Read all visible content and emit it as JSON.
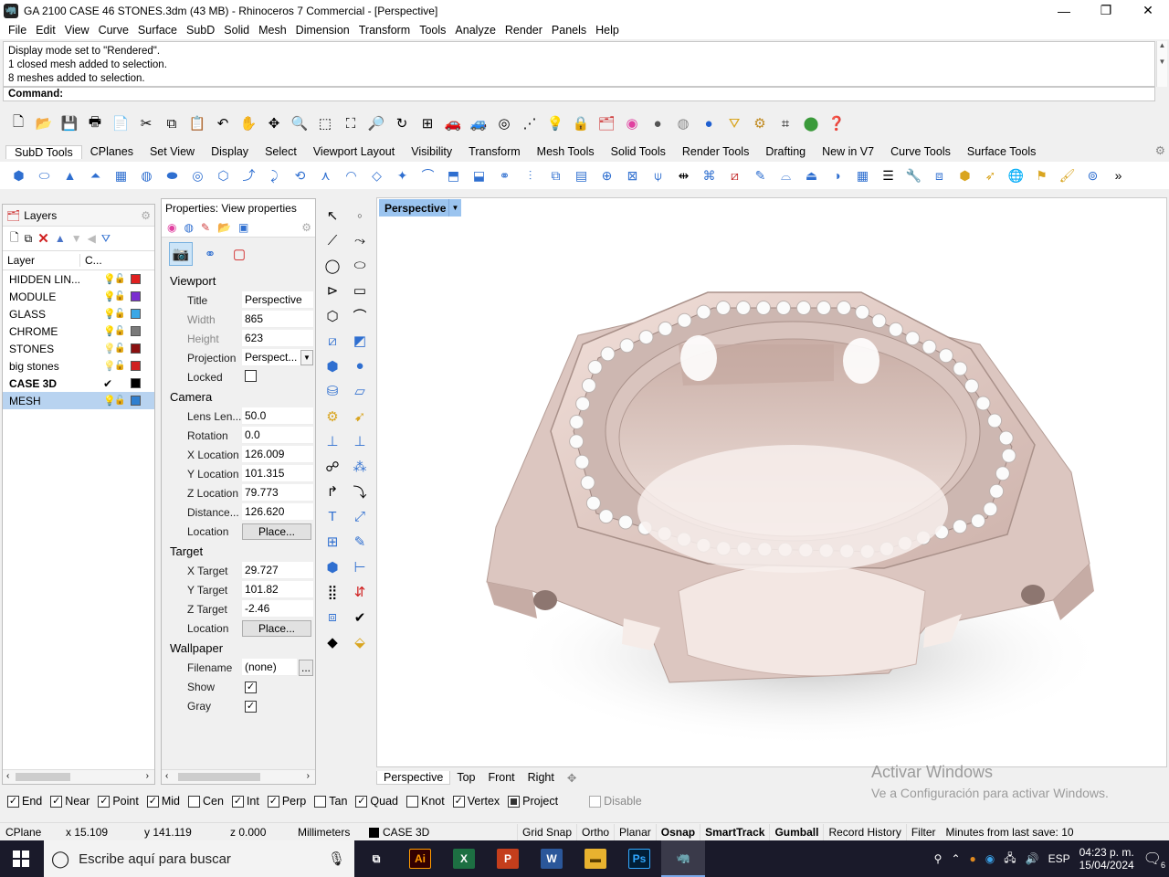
{
  "window": {
    "title": "GA 2100 CASE 46 STONES.3dm (43 MB) - Rhinoceros 7 Commercial - [Perspective]",
    "minimize": "—",
    "maximize": "❐",
    "close": "✕"
  },
  "menu": [
    "File",
    "Edit",
    "View",
    "Curve",
    "Surface",
    "SubD",
    "Solid",
    "Mesh",
    "Dimension",
    "Transform",
    "Tools",
    "Analyze",
    "Render",
    "Panels",
    "Help"
  ],
  "command": {
    "history": [
      "Display mode set to \"Rendered\".",
      "1 closed mesh added to selection.",
      "8 meshes added to selection."
    ],
    "prompt": "Command:"
  },
  "toolbar_tabs": [
    "SubD Tools",
    "CPlanes",
    "Set View",
    "Display",
    "Select",
    "Viewport Layout",
    "Visibility",
    "Transform",
    "Mesh Tools",
    "Solid Tools",
    "Render Tools",
    "Drafting",
    "New in V7",
    "Curve Tools",
    "Surface Tools"
  ],
  "layers": {
    "tab_label": "Layers",
    "col_layer": "Layer",
    "col_color": "C...",
    "items": [
      {
        "name": "HIDDEN LIN...",
        "color": "#e02020",
        "bulb": "on",
        "current": false,
        "selected": false
      },
      {
        "name": "MODULE",
        "color": "#7b2fd0",
        "bulb": "on",
        "current": false,
        "selected": false
      },
      {
        "name": "GLASS",
        "color": "#3aa7e6",
        "bulb": "on",
        "current": false,
        "selected": false
      },
      {
        "name": "CHROME",
        "color": "#7a7a7a",
        "bulb": "on",
        "current": false,
        "selected": false
      },
      {
        "name": "STONES",
        "color": "#8b1010",
        "bulb": "off",
        "current": false,
        "selected": false
      },
      {
        "name": "big stones",
        "color": "#d02020",
        "bulb": "off",
        "current": false,
        "selected": false
      },
      {
        "name": "CASE 3D",
        "color": "#000000",
        "bulb": "none",
        "current": true,
        "selected": false
      },
      {
        "name": "MESH",
        "color": "#2f7fd0",
        "bulb": "on",
        "current": false,
        "selected": true
      }
    ]
  },
  "properties": {
    "title": "Properties: View properties",
    "viewport_section": "Viewport",
    "camera_section": "Camera",
    "target_section": "Target",
    "wallpaper_section": "Wallpaper",
    "viewport": {
      "title_label": "Title",
      "title_value": "Perspective",
      "width_label": "Width",
      "width_value": "865",
      "height_label": "Height",
      "height_value": "623",
      "projection_label": "Projection",
      "projection_value": "Perspect...",
      "locked_label": "Locked"
    },
    "camera": {
      "lens_label": "Lens Len...",
      "lens_value": "50.0",
      "rotation_label": "Rotation",
      "rotation_value": "0.0",
      "xloc_label": "X Location",
      "xloc_value": "126.009",
      "yloc_label": "Y Location",
      "yloc_value": "101.315",
      "zloc_label": "Z Location",
      "zloc_value": "79.773",
      "dist_label": "Distance...",
      "dist_value": "126.620",
      "location_label": "Location",
      "place_button": "Place..."
    },
    "target": {
      "x_label": "X Target",
      "x_value": "29.727",
      "y_label": "Y Target",
      "y_value": "101.82",
      "z_label": "Z Target",
      "z_value": "-2.46",
      "location_label": "Location",
      "place_button": "Place..."
    },
    "wallpaper": {
      "filename_label": "Filename",
      "filename_value": "(none)",
      "browse": "...",
      "show_label": "Show",
      "gray_label": "Gray"
    }
  },
  "viewport": {
    "label": "Perspective",
    "tabs": [
      "Perspective",
      "Top",
      "Front",
      "Right"
    ],
    "add_tab": "✥"
  },
  "watermark": {
    "line1": "Activar Windows",
    "line2": "Ve a Configuración para activar Windows."
  },
  "osnaps": [
    {
      "label": "End",
      "checked": true
    },
    {
      "label": "Near",
      "checked": true
    },
    {
      "label": "Point",
      "checked": true
    },
    {
      "label": "Mid",
      "checked": true
    },
    {
      "label": "Cen",
      "checked": false
    },
    {
      "label": "Int",
      "checked": true
    },
    {
      "label": "Perp",
      "checked": true
    },
    {
      "label": "Tan",
      "checked": false
    },
    {
      "label": "Quad",
      "checked": true
    },
    {
      "label": "Knot",
      "checked": false
    },
    {
      "label": "Vertex",
      "checked": true
    },
    {
      "label": "Project",
      "checked": "partial"
    },
    {
      "label": "Disable",
      "checked": false,
      "disabled": true
    }
  ],
  "status": {
    "cplane": "CPlane",
    "x": "x 15.109",
    "y": "y 141.119",
    "z": "z 0.000",
    "units": "Millimeters",
    "layer": "CASE 3D",
    "panes": [
      "Grid Snap",
      "Ortho",
      "Planar",
      "Osnap",
      "SmartTrack",
      "Gumball",
      "Record History",
      "Filter"
    ],
    "save_info": "Minutes from last save: 10"
  },
  "taskbar": {
    "search_placeholder": "Escribe aquí para buscar",
    "lang": "ESP",
    "time": "04:23 p. m.",
    "date": "15/04/2024",
    "notifications": "6"
  }
}
